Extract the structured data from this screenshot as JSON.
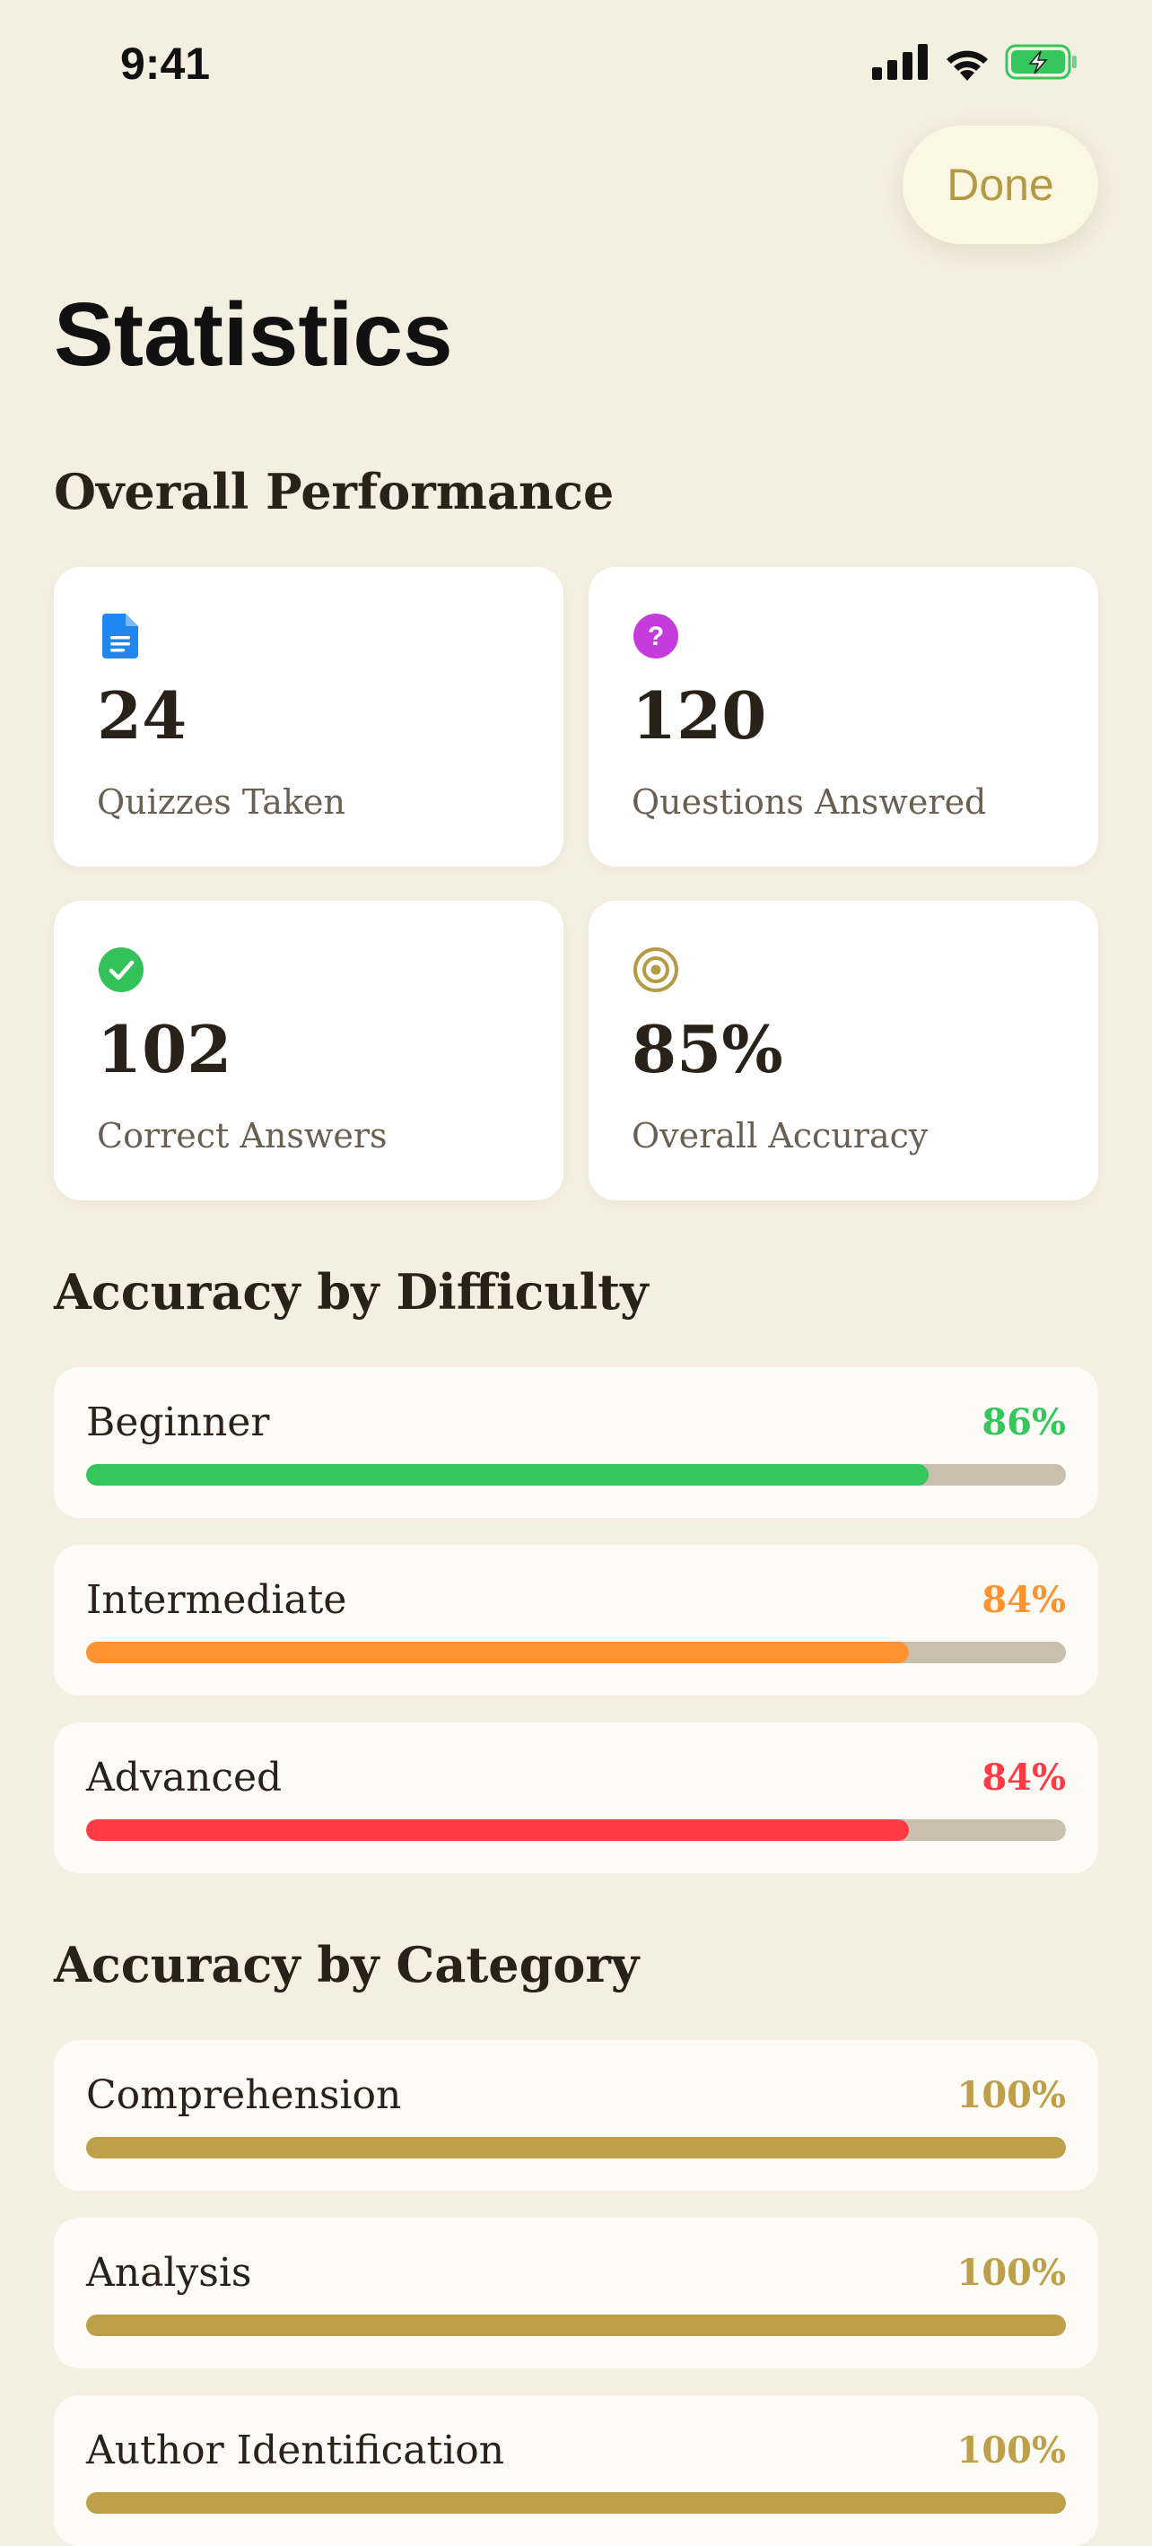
{
  "status_bar": {
    "time": "9:41",
    "icons": [
      "signal-icon",
      "wifi-icon",
      "battery-charging-icon"
    ]
  },
  "header": {
    "done_label": "Done",
    "title": "Statistics"
  },
  "sections": {
    "overall": "Overall Performance",
    "difficulty": "Accuracy by Difficulty",
    "category": "Accuracy by Category"
  },
  "stats": [
    {
      "value": "24",
      "label": "Quizzes Taken",
      "icon": "document-icon",
      "color": "#1E88F0"
    },
    {
      "value": "120",
      "label": "Questions Answered",
      "icon": "question-circle-icon",
      "color": "#C63BDB"
    },
    {
      "value": "102",
      "label": "Correct Answers",
      "icon": "checkmark-circle-icon",
      "color": "#33C25A"
    },
    {
      "value": "85%",
      "label": "Overall Accuracy",
      "icon": "target-icon",
      "color": "#B59A45"
    }
  ],
  "difficulty": [
    {
      "label": "Beginner",
      "value": "86%",
      "fraction": 0.86,
      "color": "#37C65D"
    },
    {
      "label": "Intermediate",
      "value": "84%",
      "fraction": 0.84,
      "color": "#FF9231"
    },
    {
      "label": "Advanced",
      "value": "84%",
      "fraction": 0.84,
      "color": "#FF3B45"
    }
  ],
  "category": [
    {
      "label": "Comprehension",
      "value": "100%",
      "fraction": 1.0,
      "color": "#BE9F4A"
    },
    {
      "label": "Analysis",
      "value": "100%",
      "fraction": 1.0,
      "color": "#BE9F4A"
    },
    {
      "label": "Author Identification",
      "value": "100%",
      "fraction": 1.0,
      "color": "#BE9F4A"
    }
  ],
  "colors": {
    "background": "#F5EFE2",
    "accent": "#B59A45",
    "track": "#C8BFAF"
  }
}
